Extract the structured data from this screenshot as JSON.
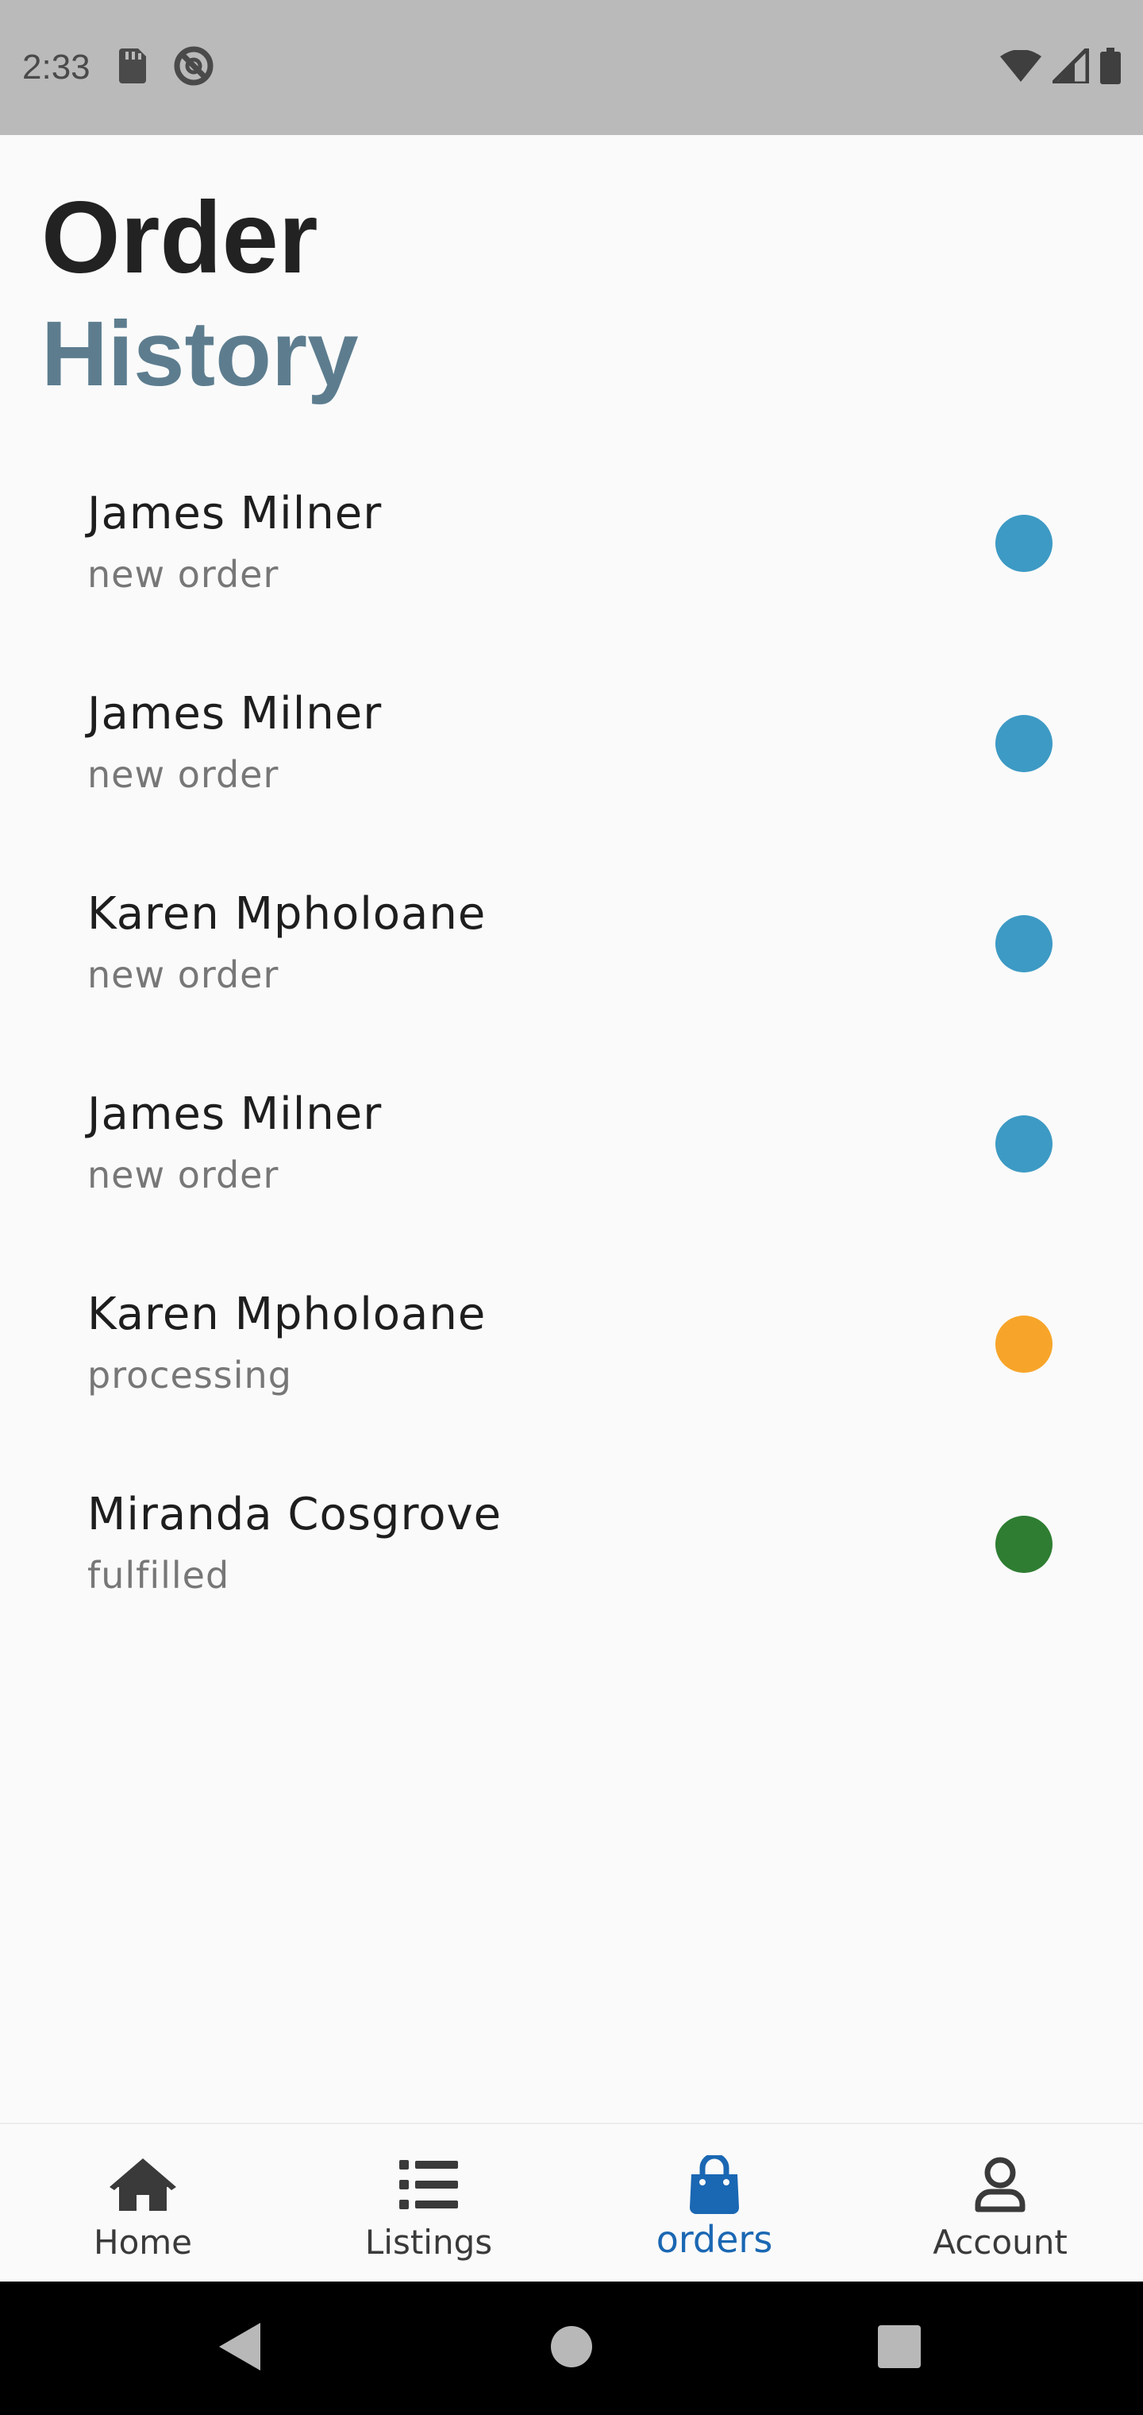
{
  "status_bar": {
    "time": "2:33",
    "icons": [
      "sd-card-icon",
      "do-not-disturb-icon",
      "wifi-icon",
      "signal-icon",
      "battery-icon"
    ]
  },
  "header": {
    "title_line1": "Order",
    "title_line2": "History"
  },
  "colors": {
    "new_order": "#3d9ac4",
    "processing": "#f7a52a",
    "fulfilled": "#2e7d32",
    "accent": "#1a67b3"
  },
  "orders": [
    {
      "name": "James Milner",
      "status": "new order",
      "status_color": "#3d9ac4"
    },
    {
      "name": "James Milner",
      "status": "new order",
      "status_color": "#3d9ac4"
    },
    {
      "name": "Karen Mpholoane",
      "status": "new order",
      "status_color": "#3d9ac4"
    },
    {
      "name": "James Milner",
      "status": "new order",
      "status_color": "#3d9ac4"
    },
    {
      "name": "Karen Mpholoane",
      "status": "processing",
      "status_color": "#f7a52a"
    },
    {
      "name": "Miranda Cosgrove",
      "status": "fulfilled",
      "status_color": "#2e7d32"
    }
  ],
  "bottom_nav": {
    "items": [
      {
        "label": "Home",
        "icon": "home-icon",
        "active": false
      },
      {
        "label": "Listings",
        "icon": "list-icon",
        "active": false
      },
      {
        "label": "orders",
        "icon": "shopping-bag-icon",
        "active": true
      },
      {
        "label": "Account",
        "icon": "account-icon",
        "active": false
      }
    ]
  },
  "system_nav": {
    "icons": [
      "back-icon",
      "home-circle-icon",
      "recents-icon"
    ]
  }
}
